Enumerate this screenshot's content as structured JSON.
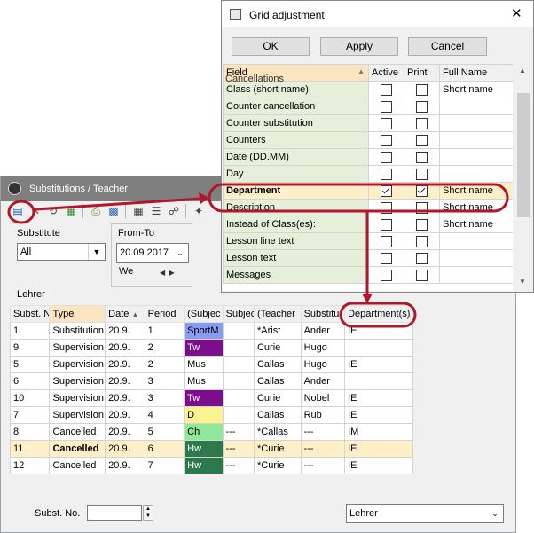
{
  "sub_window": {
    "title": "Substitutions / Teacher",
    "substitute_label": "Substitute",
    "substitute_value": "All",
    "fromto_label": "From-To",
    "date_value": "20.09.2017",
    "day_value": "We",
    "group_label": "Lehrer",
    "columns": [
      "Subst. N",
      "Type",
      "Date",
      "Period",
      "(Subjec",
      "Subjec",
      "(Teacher",
      "Substitu",
      "Department(s)"
    ],
    "rows": [
      {
        "no": "1",
        "type": "Substitution",
        "date": "20.9.",
        "period": "1",
        "subj": "SportM",
        "subj2": "",
        "teacher": "*Arist",
        "subst": "Ander",
        "dept": "IE",
        "color": "#8a9bf2"
      },
      {
        "no": "9",
        "type": "Supervision",
        "date": "20.9.",
        "period": "2",
        "subj": "Tw",
        "subj2": "",
        "teacher": "Curie",
        "subst": "Hugo",
        "dept": "",
        "color": "#7a0e8c"
      },
      {
        "no": "5",
        "type": "Supervision",
        "date": "20.9.",
        "period": "2",
        "subj": "Mus",
        "subj2": "",
        "teacher": "Callas",
        "subst": "Hugo",
        "dept": "IE",
        "color": ""
      },
      {
        "no": "6",
        "type": "Supervision",
        "date": "20.9.",
        "period": "3",
        "subj": "Mus",
        "subj2": "",
        "teacher": "Callas",
        "subst": "Ander",
        "dept": "",
        "color": ""
      },
      {
        "no": "10",
        "type": "Supervision",
        "date": "20.9.",
        "period": "3",
        "subj": "Tw",
        "subj2": "",
        "teacher": "Curie",
        "subst": "Nobel",
        "dept": "IE",
        "color": "#7a0e8c"
      },
      {
        "no": "7",
        "type": "Supervision",
        "date": "20.9.",
        "period": "4",
        "subj": "D",
        "subj2": "",
        "teacher": "Callas",
        "subst": "Rub",
        "dept": "IE",
        "color": "#fbf38f"
      },
      {
        "no": "8",
        "type": "Cancelled",
        "date": "20.9.",
        "period": "5",
        "subj": "Ch",
        "subj2": "---",
        "teacher": "*Callas",
        "subst": "---",
        "dept": "IM",
        "color": "#92e89a"
      },
      {
        "no": "11",
        "type": "Cancelled",
        "date": "20.9.",
        "period": "6",
        "subj": "Hw",
        "subj2": "---",
        "teacher": "*Curie",
        "subst": "---",
        "dept": "IE",
        "color": "#2c7a4c"
      },
      {
        "no": "12",
        "type": "Cancelled",
        "date": "20.9.",
        "period": "7",
        "subj": "Hw",
        "subj2": "---",
        "teacher": "*Curie",
        "subst": "---",
        "dept": "IE",
        "color": "#2c7a4c"
      }
    ],
    "footer_label": "Subst. No.",
    "footer_combo": "Lehrer"
  },
  "dialog": {
    "title": "Grid adjustment",
    "ok": "OK",
    "apply": "Apply",
    "cancel": "Cancel",
    "columns": [
      "Field",
      "Active",
      "Print",
      "Full Name"
    ],
    "partial_top": "Cancellations",
    "rows": [
      {
        "field": "Class (short name)",
        "active": false,
        "print": false,
        "full": "Short name"
      },
      {
        "field": "Counter cancellation",
        "active": false,
        "print": false,
        "full": ""
      },
      {
        "field": "Counter substitution",
        "active": false,
        "print": false,
        "full": ""
      },
      {
        "field": "Counters",
        "active": false,
        "print": false,
        "full": ""
      },
      {
        "field": "Date (DD.MM)",
        "active": false,
        "print": false,
        "full": ""
      },
      {
        "field": "Day",
        "active": false,
        "print": false,
        "full": ""
      },
      {
        "field": "Department",
        "active": true,
        "print": true,
        "full": "Short name"
      },
      {
        "field": "Description",
        "active": false,
        "print": false,
        "full": "Short name"
      },
      {
        "field": "Instead of Class(es):",
        "active": false,
        "print": false,
        "full": "Short name"
      },
      {
        "field": "Lesson line text",
        "active": false,
        "print": false,
        "full": ""
      },
      {
        "field": "Lesson text",
        "active": false,
        "print": false,
        "full": ""
      },
      {
        "field": "Messages",
        "active": false,
        "print": false,
        "full": ""
      }
    ]
  },
  "colors": {
    "annotation": "#b1162a",
    "selected_row": "#fdf0c8",
    "field_col": "#e6efd9"
  }
}
